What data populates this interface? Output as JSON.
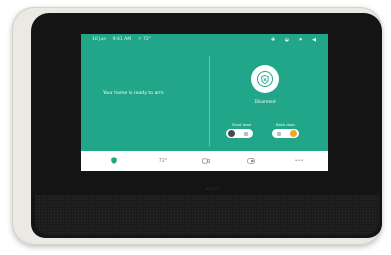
{
  "status_bar": {
    "date": "10 Jun",
    "time": "9:41 AM",
    "weather": "☼ 72°"
  },
  "main": {
    "message": "Your home is ready to arm",
    "system_status": "Disarmed",
    "doors": [
      {
        "label": "Front door",
        "state": "unlocked"
      },
      {
        "label": "Back door",
        "state": "locked"
      }
    ]
  },
  "nav": {
    "items": [
      {
        "name": "security",
        "label": ""
      },
      {
        "name": "thermostat",
        "label": "72°"
      },
      {
        "name": "camera",
        "label": ""
      },
      {
        "name": "lock",
        "label": ""
      },
      {
        "name": "more",
        "label": "•••"
      }
    ]
  },
  "colors": {
    "accent": "#21a68a",
    "lock_active": "#f0a531",
    "bezel": "#141414",
    "frame": "#ebe9e3"
  }
}
